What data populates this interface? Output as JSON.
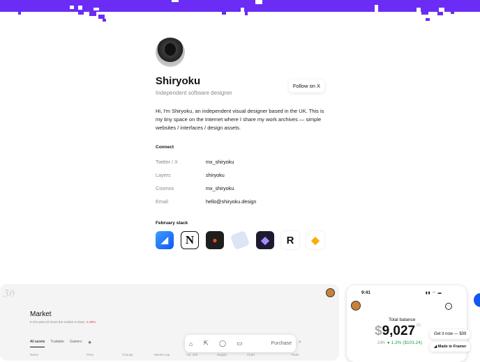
{
  "colors": {
    "accent": "#6b2cf5",
    "muted": "#8a8a8a",
    "negative": "#e34",
    "positive": "#1aa34a"
  },
  "profile": {
    "name": "Shiryoku",
    "subtitle": "Independent software designer",
    "follow_label": "Follow on X",
    "bio": "Hi, I'm Shiryoku, an independent visual designer based in the UK. This is my tiny space on the Internet where I share my work archives — simple websites / interfaces / design assets.",
    "connect_title": "Connect",
    "connect": [
      {
        "key": "Twitter / X",
        "value": "mx_shiryoku"
      },
      {
        "key": "Layers",
        "value": "shiryoku"
      },
      {
        "key": "Cosmos",
        "value": "mx_shiryoku"
      },
      {
        "key": "Email",
        "value": "hello@shiryoku.design"
      }
    ],
    "stack_title": "February stack",
    "stack": [
      "framer-icon",
      "notion-icon",
      "figma-icon",
      "linear-icon",
      "obsidian-icon",
      "raycast-icon",
      "sketch-icon"
    ]
  },
  "market": {
    "title": "Market",
    "subtitle": "In the past 24 hours the market is down",
    "change": "-1.66%",
    "tabs": [
      "All assets",
      "Tradable",
      "Gainers"
    ],
    "columns": [
      "Name",
      "Price",
      "Change",
      "Market cap",
      "Vol. 24h",
      "Supply",
      "Chart",
      "Trade"
    ]
  },
  "dock": {
    "purchase_label": "Purchase"
  },
  "wallet": {
    "time": "9:41",
    "total_label": "Total balance",
    "currency": "$",
    "amount": "9,027",
    "cents": ".00",
    "period": "24h",
    "change": "1.3% ($103.24)"
  },
  "promo": {
    "get_it": "Get it now — $39",
    "made_in": "Made in Framer"
  }
}
